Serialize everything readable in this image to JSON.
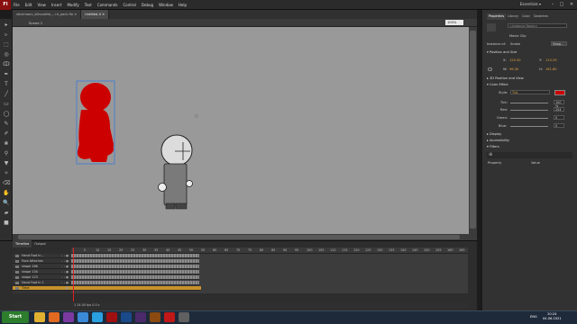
{
  "app": {
    "logo": "Fl",
    "menu": [
      "File",
      "Edit",
      "View",
      "Insert",
      "Modify",
      "Text",
      "Commands",
      "Control",
      "Debug",
      "Window",
      "Help"
    ],
    "workspace": "Essentials ▾",
    "window_controls": [
      "–",
      "□",
      "✕"
    ]
  },
  "doc_tabs": [
    {
      "label": "stickmanx_silhouette_...nt_pack.fla ✕",
      "active": false
    },
    {
      "label": "Untitled-4 ✕",
      "active": true
    }
  ],
  "editbar": {
    "scene": "Scene 1",
    "zoom": "100%"
  },
  "toolbar_icons": [
    "arrow-icon",
    "subselect-icon",
    "free-transform-icon",
    "3d-rotation-icon",
    "lasso-icon",
    "pen-icon",
    "text-icon",
    "line-icon",
    "rectangle-icon",
    "oval-icon",
    "pencil-icon",
    "brush-icon",
    "deco-icon",
    "bone-icon",
    "paint-bucket-icon",
    "eyedropper-icon",
    "eraser-icon",
    "hand-icon",
    "zoom-icon",
    "stroke-color-icon",
    "fill-color-icon"
  ],
  "timeline": {
    "tabs": [
      {
        "label": "Timeline",
        "active": true
      },
      {
        "label": "Output",
        "active": false
      }
    ],
    "ruler": [
      "1",
      "5",
      "10",
      "15",
      "20",
      "25",
      "30",
      "35",
      "40",
      "45",
      "50",
      "55",
      "60",
      "65",
      "70",
      "75",
      "80",
      "85",
      "90",
      "95",
      "100",
      "105",
      "110",
      "115",
      "120",
      "125",
      "130",
      "135",
      "140",
      "145",
      "150",
      "155",
      "160",
      "165"
    ],
    "layers": [
      {
        "name": "Hand Foot In...",
        "selected": false
      },
      {
        "name": "Face Attaches",
        "selected": false
      },
      {
        "name": "shape 186",
        "selected": false
      },
      {
        "name": "shape 134",
        "selected": false
      },
      {
        "name": "shape 123",
        "selected": false
      },
      {
        "name": "Hand Foot In 1",
        "selected": false
      },
      {
        "name": "Time",
        "selected": true
      }
    ],
    "status": "1   24.00 fps   0.0 s"
  },
  "properties": {
    "tabs": [
      {
        "label": "Properties",
        "active": true
      },
      {
        "label": "Library",
        "active": false
      },
      {
        "label": "Color",
        "active": false
      },
      {
        "label": "Swatches",
        "active": false
      }
    ],
    "instance_name_placeholder": "<Instance Name>",
    "symbol_type": "Movie Clip",
    "instance_of_label": "Instance of:",
    "instance_of_value": "Snake",
    "swap_label": "Swap...",
    "sections": {
      "position": "▾ Position and Size",
      "threed": "▸ 3D Position and View",
      "color": "▾ Color Effect",
      "display": "▸ Display",
      "accessibility": "▸ Accessibility",
      "filters": "▾ Filters"
    },
    "pos": {
      "x_label": "X:",
      "x": "120.30",
      "y_label": "Y:",
      "y": "115.29",
      "w_label": "W:",
      "w": "96.30",
      "h_label": "H:",
      "h": "161.80"
    },
    "color_effect": {
      "style_label": "Style:",
      "style_value": "Tint",
      "tint_label": "Tint:",
      "tint_value": "100 %",
      "red_label": "Red:",
      "red_value": "204",
      "green_label": "Green:",
      "green_value": "0",
      "blue_label": "Blue:",
      "blue_value": "0",
      "swatch": "#cc0000"
    },
    "filters_cols": [
      "Property",
      "Value"
    ]
  },
  "taskbar": {
    "start": "Start",
    "lang": "ENG",
    "time": "20:24",
    "date": "04.06.2021",
    "icons": [
      {
        "name": "explorer-icon",
        "color": "#e0b030"
      },
      {
        "name": "firefox-icon",
        "color": "#e06a20"
      },
      {
        "name": "media-icon",
        "color": "#7a3aa0"
      },
      {
        "name": "chrome-icon",
        "color": "#3a8ad8"
      },
      {
        "name": "skype-icon",
        "color": "#2aa0e0"
      },
      {
        "name": "animate-icon",
        "color": "#a01010"
      },
      {
        "name": "photoshop-icon",
        "color": "#1a4a8a"
      },
      {
        "name": "premiere-icon",
        "color": "#4a2a6a"
      },
      {
        "name": "illustrator-icon",
        "color": "#8a4a10"
      },
      {
        "name": "opera-icon",
        "color": "#c01818"
      },
      {
        "name": "app-icon",
        "color": "#606060"
      }
    ]
  },
  "colors": {
    "stage": "#999999",
    "silhouette": "#cc0000",
    "selected_layer": "#c7922a",
    "playhead": "#e02020"
  }
}
